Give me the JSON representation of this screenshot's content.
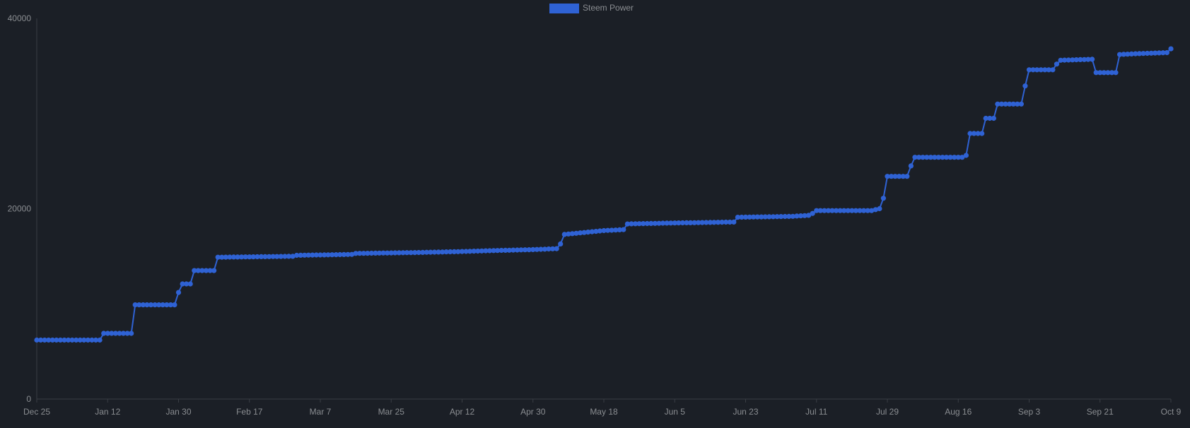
{
  "chart_data": {
    "type": "line",
    "legend": {
      "position": "top-center"
    },
    "ylim": [
      0,
      40000
    ],
    "y_ticks": [
      "0",
      "20000",
      "40000"
    ],
    "x_tick_labels": [
      "Dec 25",
      "Jan 12",
      "Jan 30",
      "Feb 17",
      "Mar 7",
      "Mar 25",
      "Apr 12",
      "Apr 30",
      "May 18",
      "Jun 5",
      "Jun 23",
      "Jul 11",
      "Jul 29",
      "Aug 16",
      "Sep 3",
      "Sep 21",
      "Oct 9"
    ],
    "grid": false,
    "colors": {
      "series": "#2f62d4",
      "background": "#1b1f26",
      "axis": "#3a3e44",
      "text": "#8a8d91"
    },
    "series": [
      {
        "name": "Steem Power",
        "points": [
          [
            "Dec 25",
            6200
          ],
          [
            "Jan 10",
            6200
          ],
          [
            "Jan 11",
            6900
          ],
          [
            "Jan 18",
            6900
          ],
          [
            "Jan 19",
            9900
          ],
          [
            "Jan 29",
            9900
          ],
          [
            "Jan 30",
            11200
          ],
          [
            "Jan 31",
            12100
          ],
          [
            "Feb 2",
            12100
          ],
          [
            "Feb 3",
            13500
          ],
          [
            "Feb 8",
            13500
          ],
          [
            "Feb 9",
            14900
          ],
          [
            "Feb 28",
            15000
          ],
          [
            "Mar 1",
            15100
          ],
          [
            "Mar 15",
            15200
          ],
          [
            "Mar 16",
            15300
          ],
          [
            "Apr 1",
            15400
          ],
          [
            "Apr 12",
            15500
          ],
          [
            "Apr 20",
            15600
          ],
          [
            "Apr 30",
            15700
          ],
          [
            "May 6",
            15800
          ],
          [
            "May 7",
            16300
          ],
          [
            "May 8",
            17300
          ],
          [
            "May 13",
            17500
          ],
          [
            "May 18",
            17700
          ],
          [
            "May 23",
            17800
          ],
          [
            "May 24",
            18400
          ],
          [
            "Jun 5",
            18500
          ],
          [
            "Jun 20",
            18600
          ],
          [
            "Jun 21",
            19100
          ],
          [
            "Jul 5",
            19200
          ],
          [
            "Jul 9",
            19300
          ],
          [
            "Jul 10",
            19500
          ],
          [
            "Jul 11",
            19800
          ],
          [
            "Jul 25",
            19800
          ],
          [
            "Jul 27",
            20000
          ],
          [
            "Jul 28",
            21100
          ],
          [
            "Jul 29",
            23400
          ],
          [
            "Aug 3",
            23400
          ],
          [
            "Aug 4",
            24500
          ],
          [
            "Aug 5",
            25400
          ],
          [
            "Aug 17",
            25400
          ],
          [
            "Aug 18",
            25600
          ],
          [
            "Aug 19",
            27900
          ],
          [
            "Aug 22",
            27900
          ],
          [
            "Aug 23",
            29500
          ],
          [
            "Aug 25",
            29500
          ],
          [
            "Aug 26",
            31000
          ],
          [
            "Sep 1",
            31000
          ],
          [
            "Sep 2",
            32900
          ],
          [
            "Sep 3",
            34600
          ],
          [
            "Sep 9",
            34600
          ],
          [
            "Sep 10",
            35200
          ],
          [
            "Sep 11",
            35600
          ],
          [
            "Sep 19",
            35700
          ],
          [
            "Sep 20",
            34300
          ],
          [
            "Sep 25",
            34300
          ],
          [
            "Sep 26",
            36200
          ],
          [
            "Oct 1",
            36300
          ],
          [
            "Oct 8",
            36400
          ],
          [
            "Oct 9",
            36800
          ]
        ]
      }
    ]
  }
}
